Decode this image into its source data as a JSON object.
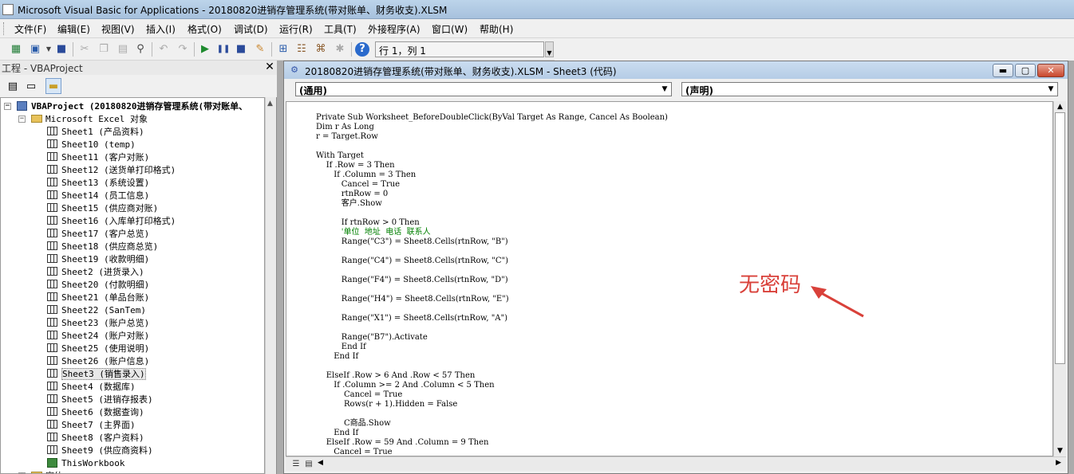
{
  "window": {
    "title": "Microsoft Visual Basic for Applications - 20180820进销存管理系统(带对账单、财务收支).XLSM"
  },
  "menu": {
    "items": [
      "文件(F)",
      "编辑(E)",
      "视图(V)",
      "插入(I)",
      "格式(O)",
      "调试(D)",
      "运行(R)",
      "工具(T)",
      "外接程序(A)",
      "窗口(W)",
      "帮助(H)"
    ]
  },
  "toolbar": {
    "position": "行 1，列 1"
  },
  "project": {
    "title": "工程 - VBAProject",
    "close_glyph": "✕",
    "root": "VBAProject (20180820进销存管理系统(带对账单、",
    "folder": "Microsoft Excel 对象",
    "sheets": [
      "Sheet1 (产品资料)",
      "Sheet10 (temp)",
      "Sheet11 (客户对账)",
      "Sheet12 (送货单打印格式)",
      "Sheet13 (系统设置)",
      "Sheet14 (员工信息)",
      "Sheet15 (供应商对账)",
      "Sheet16 (入库单打印格式)",
      "Sheet17 (客户总览)",
      "Sheet18 (供应商总览)",
      "Sheet19 (收款明细)",
      "Sheet2 (进货录入)",
      "Sheet20 (付款明细)",
      "Sheet21 (单品台账)",
      "Sheet22 (SanTem)",
      "Sheet23 (账户总览)",
      "Sheet24 (账户对账)",
      "Sheet25 (使用说明)",
      "Sheet26 (账户信息)",
      "Sheet3 (销售录入)",
      "Sheet4 (数据库)",
      "Sheet5 (进销存报表)",
      "Sheet6 (数据查询)",
      "Sheet7 (主界面)",
      "Sheet8 (客户资料)",
      "Sheet9 (供应商资料)",
      "ThisWorkbook"
    ],
    "next_folder": "窗体"
  },
  "code_window": {
    "title": "20180820进销存管理系统(带对账单、财务收支).XLSM - Sheet3 (代码)",
    "object_combo": "(通用)",
    "proc_combo": "(声明)",
    "lines": [
      "Private Sub Worksheet_BeforeDoubleClick(ByVal Target As Range, Cancel As Boolean)",
      "Dim r As Long",
      "r = Target.Row",
      "",
      "With Target",
      "    If .Row = 3 Then",
      "       If .Column = 3 Then",
      "          Cancel = True",
      "          rtnRow = 0",
      "          客户.Show",
      "",
      "          If rtnRow > 0 Then",
      "          '单位  地址  电话  联系人",
      "          Range(\"C3\") = Sheet8.Cells(rtnRow, \"B\")",
      "",
      "          Range(\"C4\") = Sheet8.Cells(rtnRow, \"C\")",
      "",
      "          Range(\"F4\") = Sheet8.Cells(rtnRow, \"D\")",
      "",
      "          Range(\"H4\") = Sheet8.Cells(rtnRow, \"E\")",
      "",
      "          Range(\"X1\") = Sheet8.Cells(rtnRow, \"A\")",
      "",
      "          Range(\"B7\").Activate",
      "          End If",
      "       End If",
      "",
      "    ElseIf .Row > 6 And .Row < 57 Then",
      "       If .Column >= 2 And .Column < 5 Then",
      "           Cancel = True",
      "           Rows(r + 1).Hidden = False",
      "",
      "           C商品.Show",
      "       End If",
      "    ElseIf .Row = 59 And .Column = 9 Then",
      "       Cancel = True"
    ]
  },
  "annotation": {
    "text": "无密码",
    "color": "#d9413a"
  },
  "icons": [
    "excel-icon",
    "insert-userform-icon",
    "save-icon",
    "cut-icon",
    "copy-icon",
    "paste-icon",
    "find-icon",
    "undo-icon",
    "redo-icon",
    "run-icon",
    "break-icon",
    "reset-icon",
    "design-mode-icon",
    "project-explorer-icon",
    "properties-icon",
    "object-browser-icon",
    "toolbox-icon",
    "help-icon"
  ]
}
